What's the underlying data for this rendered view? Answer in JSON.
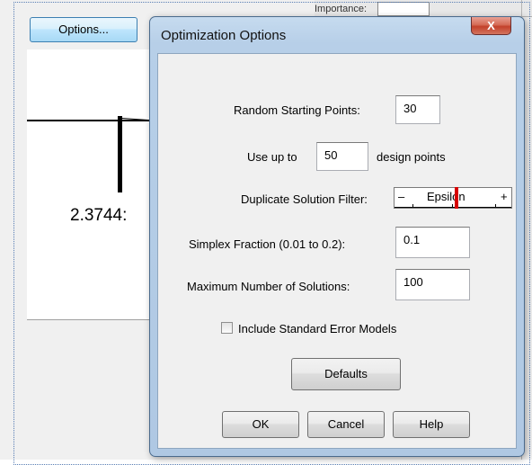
{
  "background": {
    "options_button": "Options...",
    "importance_label": "Importance:",
    "plot_value": "2.3744:"
  },
  "dialog": {
    "title": "Optimization Options",
    "close_label": "X",
    "random_starting_points": {
      "label": "Random Starting Points:",
      "value": "30"
    },
    "design_points": {
      "prefix": "Use up to",
      "value": "50",
      "suffix": "design points"
    },
    "duplicate_filter": {
      "label": "Duplicate Solution Filter:",
      "minus": "–",
      "plus": "+",
      "slider_text": "Epsilon",
      "level": 0.5
    },
    "simplex_fraction": {
      "label": "Simplex Fraction (0.01 to 0.2):",
      "value": "0.1"
    },
    "max_solutions": {
      "label": "Maximum Number of Solutions:",
      "value": "100"
    },
    "include_error_models": {
      "label": "Include Standard Error Models",
      "checked": false
    },
    "defaults_button": "Defaults",
    "ok_button": "OK",
    "cancel_button": "Cancel",
    "help_button": "Help"
  }
}
